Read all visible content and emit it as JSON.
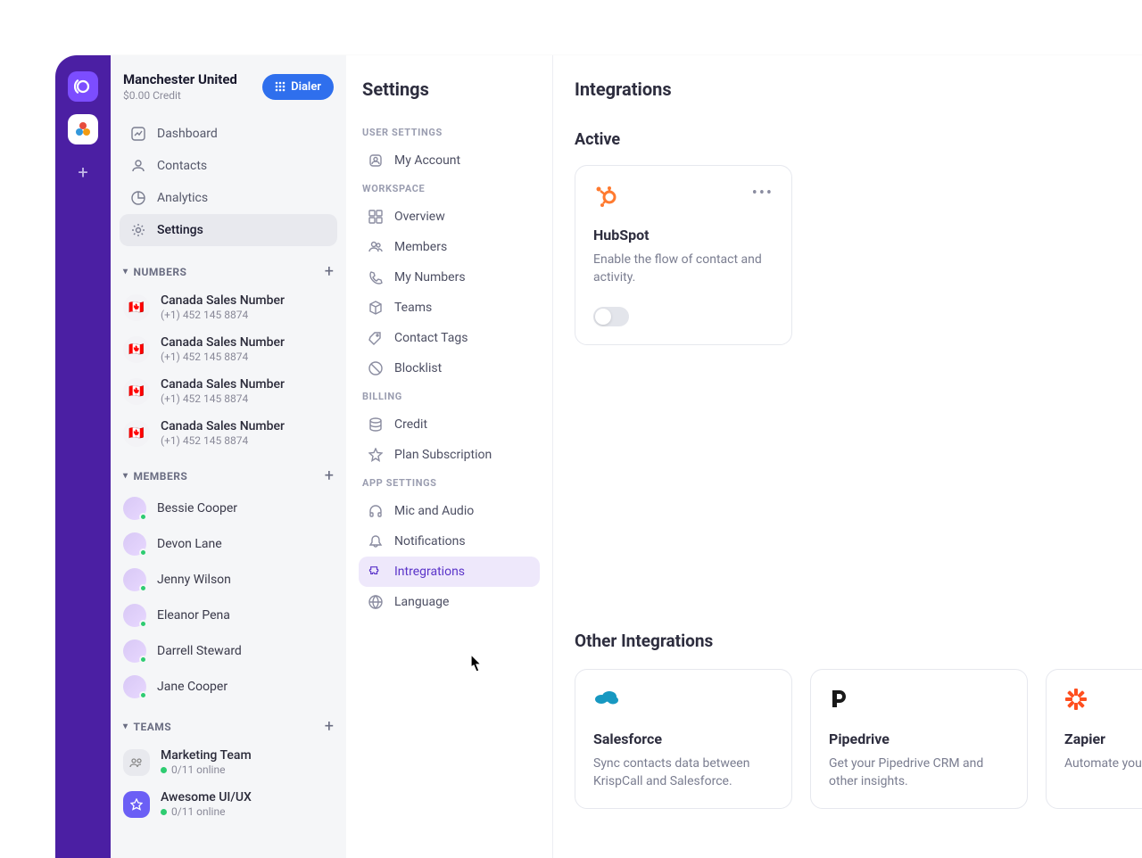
{
  "workspace": {
    "name": "Manchester United",
    "credit": "$0.00 Credit"
  },
  "dialer_label": "Dialer",
  "nav": {
    "dashboard": "Dashboard",
    "contacts": "Contacts",
    "analytics": "Analytics",
    "settings": "Settings"
  },
  "sections": {
    "numbers": "NUMBERS",
    "members": "MEMBERS",
    "teams": "TEAMS"
  },
  "numbers": [
    {
      "name": "Canada Sales Number",
      "value": "(+1) 452 145 8874"
    },
    {
      "name": "Canada Sales Number",
      "value": "(+1) 452 145 8874"
    },
    {
      "name": "Canada Sales Number",
      "value": "(+1) 452 145 8874"
    },
    {
      "name": "Canada Sales Number",
      "value": "(+1) 452 145 8874"
    }
  ],
  "members": [
    {
      "name": "Bessie Cooper"
    },
    {
      "name": "Devon Lane"
    },
    {
      "name": "Jenny Wilson"
    },
    {
      "name": "Eleanor Pena"
    },
    {
      "name": "Darrell Steward"
    },
    {
      "name": "Jane Cooper"
    }
  ],
  "teams": [
    {
      "name": "Marketing Team",
      "status": "0/11 online"
    },
    {
      "name": "Awesome UI/UX",
      "status": "0/11 online"
    }
  ],
  "settings_panel": {
    "title": "Settings",
    "groups": {
      "user": "USER SETTINGS",
      "workspace": "WORKSPACE",
      "billing": "BILLING",
      "app": "APP SETTINGS"
    },
    "items": {
      "my_account": "My Account",
      "overview": "Overview",
      "members": "Members",
      "my_numbers": "My Numbers",
      "teams": "Teams",
      "contact_tags": "Contact Tags",
      "blocklist": "Blocklist",
      "credit": "Credit",
      "plan": "Plan Subscription",
      "mic": "Mic and Audio",
      "notifications": "Notifications",
      "integrations": "Intregrations",
      "language": "Language"
    }
  },
  "main": {
    "title": "Integrations",
    "active_label": "Active",
    "other_label": "Other Integrations",
    "active_card": {
      "name": "HubSpot",
      "desc": "Enable the flow of contact and activity."
    },
    "others": [
      {
        "name": "Salesforce",
        "desc": "Sync contacts data between KrispCall and Salesforce."
      },
      {
        "name": "Pipedrive",
        "desc": "Get your Pipedrive CRM and other insights."
      },
      {
        "name": "Zapier",
        "desc": "Automate your integrate with"
      }
    ]
  },
  "colors": {
    "accent": "#5b34c9",
    "blue": "#2f6fed",
    "hubspot": "#ff7a2f",
    "salesforce": "#1798c1",
    "zapier": "#ff4f1f"
  }
}
